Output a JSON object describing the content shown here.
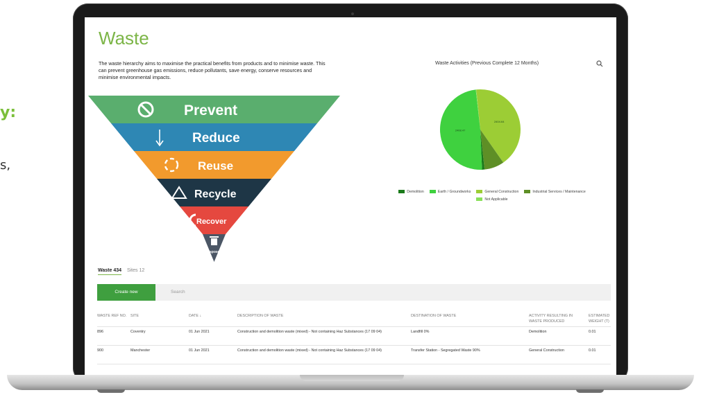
{
  "side": {
    "accent": "y:",
    "text": "s,"
  },
  "page": {
    "title": "Waste",
    "intro": "The waste hierarchy aims to maximise the practical benefits from products and to minimise waste. This can prevent greenhouse gas emissions, reduce pollutants, save energy, conserve resources and minimise environmental impacts."
  },
  "hierarchy": [
    {
      "label": "Prevent",
      "icon": "no-entry-icon",
      "color": "#5aae6e"
    },
    {
      "label": "Reduce",
      "icon": "arrow-down-icon",
      "color": "#2e87b4"
    },
    {
      "label": "Reuse",
      "icon": "cycle-icon",
      "color": "#f29a2d"
    },
    {
      "label": "Recycle",
      "icon": "recycle-icon",
      "color": "#1e3646"
    },
    {
      "label": "Recover",
      "icon": "recover-icon",
      "color": "#e5483f"
    },
    {
      "label": "Dispose",
      "icon": "bin-icon",
      "color": "#4b5665"
    }
  ],
  "chart": {
    "title": "Waste Activities (Previous Complete 12 Months)",
    "search_icon": "search-icon"
  },
  "chart_data": {
    "type": "pie",
    "title": "Waste Activities (Previous Complete 12 Months)",
    "legend_position": "bottom",
    "slices": [
      {
        "name": "Demolition",
        "value": 1.0,
        "color": "#1a7a1a"
      },
      {
        "name": "Earth / Groundworks",
        "value": 49.0,
        "color": "#3fd13f",
        "label": "2408.47"
      },
      {
        "name": "General Construction",
        "value": 42.0,
        "color": "#9ccd35",
        "label": "2404.64"
      },
      {
        "name": "Industrial Services / Maintenance",
        "value": 8.0,
        "color": "#5e8f26"
      },
      {
        "name": "Not Applicable",
        "value": 0.2,
        "color": "#89e05a"
      }
    ]
  },
  "tabs": [
    {
      "label": "Waste",
      "count": "434"
    },
    {
      "label": "Sites",
      "count": "12"
    }
  ],
  "toolbar": {
    "create_label": "Create new",
    "search_placeholder": "Search"
  },
  "table": {
    "headers": [
      "WASTE REF NO.",
      "SITE",
      "DATE ↓",
      "DESCRIPTION OF WASTE",
      "DESTINATION OF WASTE",
      "ACTIVITY RESULTING IN WASTE PRODUCED",
      "ESTIMATED WEIGHT (T)"
    ],
    "rows": [
      [
        "896",
        "Coventry",
        "01 Jun 2021",
        "Construction and demolition waste (mixed) - Not containing Haz Substances (17 09 04)",
        "Landfill 0%",
        "Demolition",
        "0.01"
      ],
      [
        "900",
        "Manchester",
        "01 Jun 2021",
        "Construction and demolition waste (mixed) - Not containing Haz Substances (17 09 04)",
        "Transfer Station - Segregated Waste 90%",
        "General Construction",
        "0.01"
      ]
    ]
  }
}
